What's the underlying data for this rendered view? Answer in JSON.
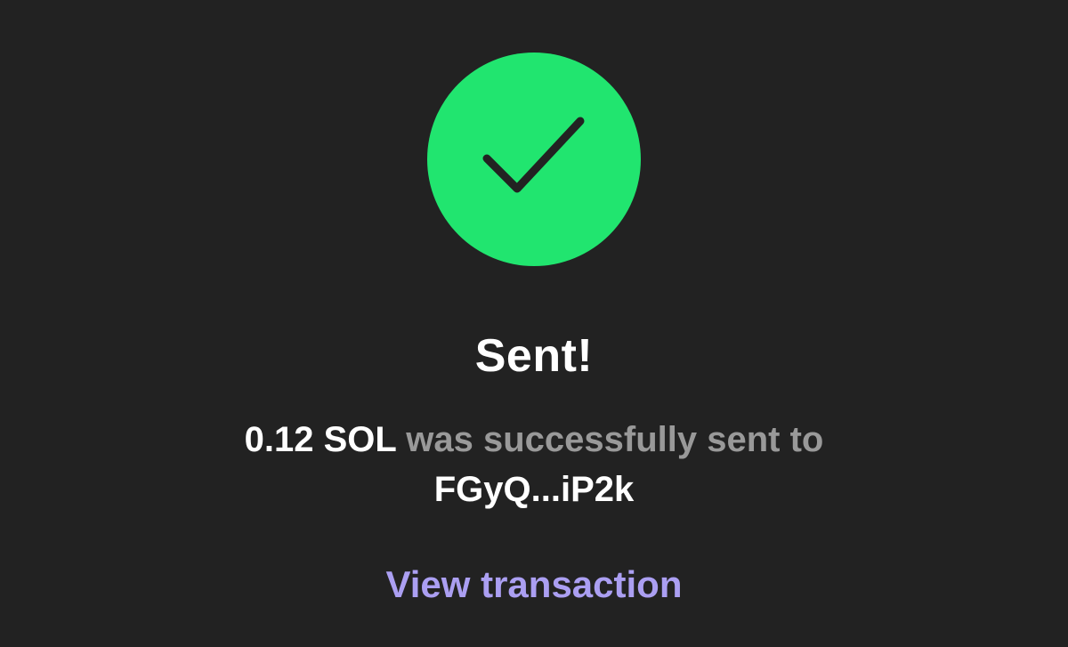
{
  "status": {
    "icon": "checkmark-icon",
    "icon_color": "#21e56f",
    "title": "Sent!"
  },
  "message": {
    "amount": "0.12 SOL",
    "text": "was successfully sent to",
    "recipient": "FGyQ...iP2k"
  },
  "actions": {
    "view_transaction_label": "View transaction"
  },
  "colors": {
    "background": "#222222",
    "success": "#21e56f",
    "link": "#ab9ff2",
    "muted_text": "#999999"
  }
}
